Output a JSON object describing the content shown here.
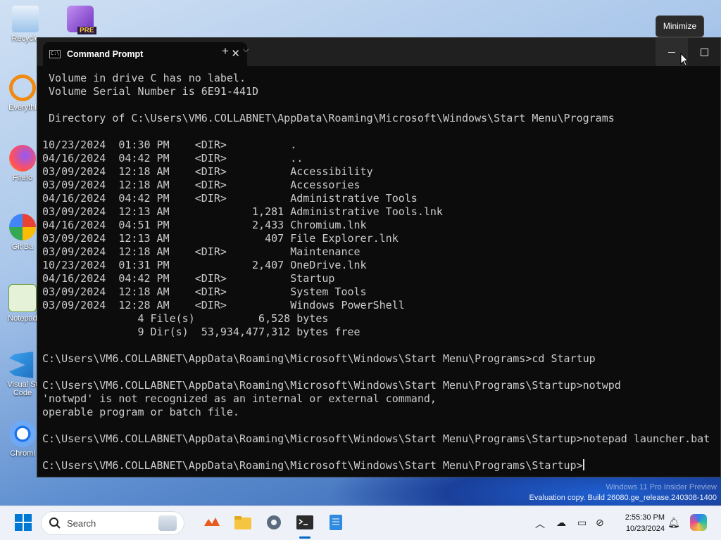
{
  "desktop": {
    "icons": [
      {
        "label": "Recycle"
      },
      {
        "label": "PRE"
      },
      {
        "label": "Everythi"
      },
      {
        "label": "Firefo"
      },
      {
        "label": "Git Ba"
      },
      {
        "label": "Notepad"
      },
      {
        "label": "Visual St Code"
      },
      {
        "label": "Chromi"
      }
    ],
    "watermark": {
      "line1": "Windows 11 Pro Insider Preview",
      "line2": "Evaluation copy. Build 26080.ge_release.240308-1400"
    }
  },
  "window": {
    "tab_title": "Command Prompt",
    "tab_icon": "cmd-icon",
    "newtab": "+",
    "dropdown": "⌵",
    "tooltip": "Minimize",
    "console_lines": [
      " Volume in drive C has no label.",
      " Volume Serial Number is 6E91-441D",
      "",
      " Directory of C:\\Users\\VM6.COLLABNET\\AppData\\Roaming\\Microsoft\\Windows\\Start Menu\\Programs",
      "",
      "10/23/2024  01:30 PM    <DIR>          .",
      "04/16/2024  04:42 PM    <DIR>          ..",
      "03/09/2024  12:18 AM    <DIR>          Accessibility",
      "03/09/2024  12:18 AM    <DIR>          Accessories",
      "04/16/2024  04:42 PM    <DIR>          Administrative Tools",
      "03/09/2024  12:13 AM             1,281 Administrative Tools.lnk",
      "04/16/2024  04:51 PM             2,433 Chromium.lnk",
      "03/09/2024  12:13 AM               407 File Explorer.lnk",
      "03/09/2024  12:18 AM    <DIR>          Maintenance",
      "10/23/2024  01:31 PM             2,407 OneDrive.lnk",
      "04/16/2024  04:42 PM    <DIR>          Startup",
      "03/09/2024  12:18 AM    <DIR>          System Tools",
      "03/09/2024  12:28 AM    <DIR>          Windows PowerShell",
      "               4 File(s)          6,528 bytes",
      "               9 Dir(s)  53,934,477,312 bytes free",
      "",
      "C:\\Users\\VM6.COLLABNET\\AppData\\Roaming\\Microsoft\\Windows\\Start Menu\\Programs>cd Startup",
      "",
      "C:\\Users\\VM6.COLLABNET\\AppData\\Roaming\\Microsoft\\Windows\\Start Menu\\Programs\\Startup>notwpd",
      "'notwpd' is not recognized as an internal or external command,",
      "operable program or batch file.",
      "",
      "C:\\Users\\VM6.COLLABNET\\AppData\\Roaming\\Microsoft\\Windows\\Start Menu\\Programs\\Startup>notepad launcher.bat",
      ""
    ],
    "prompt": "C:\\Users\\VM6.COLLABNET\\AppData\\Roaming\\Microsoft\\Windows\\Start Menu\\Programs\\Startup>"
  },
  "taskbar": {
    "search_placeholder": "Search",
    "apps": [
      "widgets-icon",
      "file-explorer-icon",
      "settings-icon",
      "terminal-icon",
      "notepad-icon"
    ],
    "time": "2:55:30 PM",
    "date": "10/23/2024"
  },
  "colors": {
    "console_bg": "#0c0c0c",
    "console_text": "#cccccc",
    "accent": "#0067c0"
  }
}
